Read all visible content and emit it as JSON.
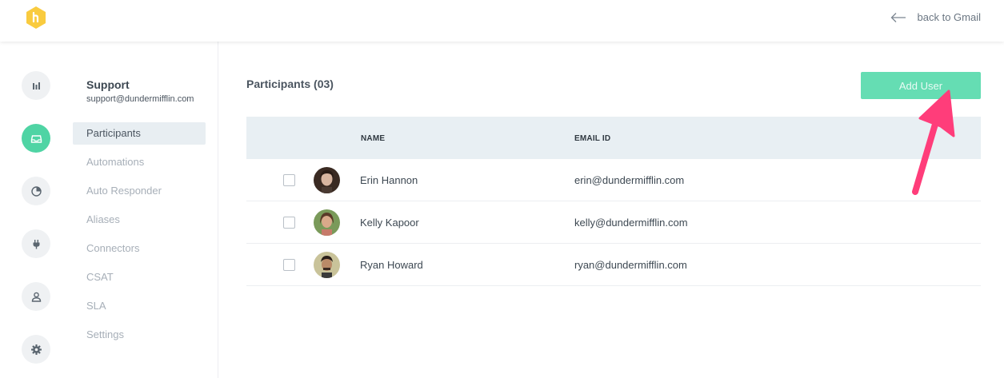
{
  "header": {
    "back_label": "back to Gmail"
  },
  "rail": {
    "items": [
      {
        "icon": "bar-chart-icon",
        "active": false
      },
      {
        "icon": "inbox-icon",
        "active": true
      },
      {
        "icon": "pie-chart-icon",
        "active": false
      },
      {
        "icon": "plug-icon",
        "active": false
      },
      {
        "icon": "user-icon",
        "active": false
      },
      {
        "icon": "gear-icon",
        "active": false
      }
    ]
  },
  "sidebar": {
    "inbox_name": "Support",
    "inbox_email": "support@dundermifflin.com",
    "items": [
      {
        "label": "Participants",
        "active": true
      },
      {
        "label": "Automations",
        "active": false
      },
      {
        "label": "Auto Responder",
        "active": false
      },
      {
        "label": "Aliases",
        "active": false
      },
      {
        "label": "Connectors",
        "active": false
      },
      {
        "label": "CSAT",
        "active": false
      },
      {
        "label": "SLA",
        "active": false
      },
      {
        "label": "Settings",
        "active": false
      }
    ]
  },
  "main": {
    "title": "Participants (03)",
    "add_button_label": "Add User",
    "columns": {
      "name": "NAME",
      "email": "EMAIL ID"
    },
    "rows": [
      {
        "name": "Erin Hannon",
        "email": "erin@dundermifflin.com",
        "checked": false
      },
      {
        "name": "Kelly Kapoor",
        "email": "kelly@dundermifflin.com",
        "checked": false
      },
      {
        "name": "Ryan Howard",
        "email": "ryan@dundermifflin.com",
        "checked": false
      }
    ]
  },
  "colors": {
    "accent": "#4fd4a4",
    "button": "#65ddb3",
    "logo": "#f9cb3f",
    "annotation": "#ff3d7a",
    "table_header": "#e8eff3"
  }
}
